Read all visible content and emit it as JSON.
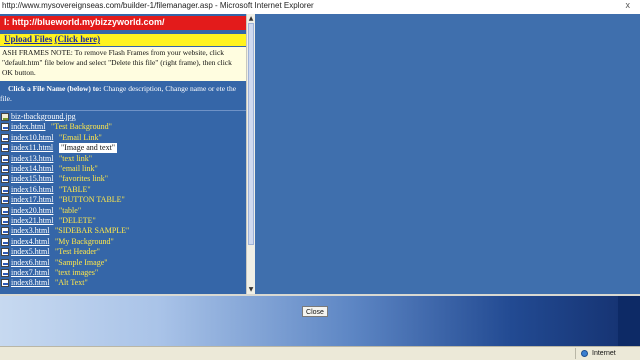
{
  "window": {
    "title": "http://www.mysovereignseas.com/builder-1/filemanager.asp - Microsoft Internet Explorer",
    "close_glyph": "x"
  },
  "left": {
    "url_bar": "l: http://blueworld.mybizzyworld.com/",
    "upload_label": "Upload Files",
    "upload_link": "(Click here)",
    "note": "ASH FRAMES NOTE: To remove Flash Frames from your website, click \"default.htm\" file below and select \"Delete this file\" (right frame), then click OK button.",
    "instruction_bold": "Click a File Name (below) to:",
    "instruction_rest": "Change description, Change name or ete the file."
  },
  "files": [
    {
      "name": "biz-tbackground.jpg",
      "desc": "",
      "type": "image"
    },
    {
      "name": "index.html",
      "desc": "\"Test Background\"",
      "type": "html"
    },
    {
      "name": "index10.html",
      "desc": "\"Email Link\"",
      "type": "html"
    },
    {
      "name": "index11.html",
      "desc": "\"Image and text\"",
      "type": "html",
      "highlight": true
    },
    {
      "name": "index13.html",
      "desc": "\"text link\"",
      "type": "html"
    },
    {
      "name": "index14.html",
      "desc": "\"email link\"",
      "type": "html"
    },
    {
      "name": "index15.html",
      "desc": "\"favorites link\"",
      "type": "html"
    },
    {
      "name": "index16.html",
      "desc": "\"TABLE\"",
      "type": "html"
    },
    {
      "name": "index17.html",
      "desc": "\"BUTTON TABLE\"",
      "type": "html"
    },
    {
      "name": "index20.html",
      "desc": "\"table\"",
      "type": "html"
    },
    {
      "name": "index21.html",
      "desc": "\"DELETE\"",
      "type": "html"
    },
    {
      "name": "index3.html",
      "desc": "\"SIDEBAR SAMPLE\"",
      "type": "html"
    },
    {
      "name": "index4.html",
      "desc": "\"My Background\"",
      "type": "html"
    },
    {
      "name": "index5.html",
      "desc": "\"Test Header\"",
      "type": "html"
    },
    {
      "name": "index6.html",
      "desc": "\"Sample Image\"",
      "type": "html"
    },
    {
      "name": "index7.html",
      "desc": "\"text images\"",
      "type": "html"
    },
    {
      "name": "index8.html",
      "desc": "\"Alt Text\"",
      "type": "html"
    }
  ],
  "bottom": {
    "close_label": "Close"
  },
  "statusbar": {
    "zone": "Internet"
  }
}
